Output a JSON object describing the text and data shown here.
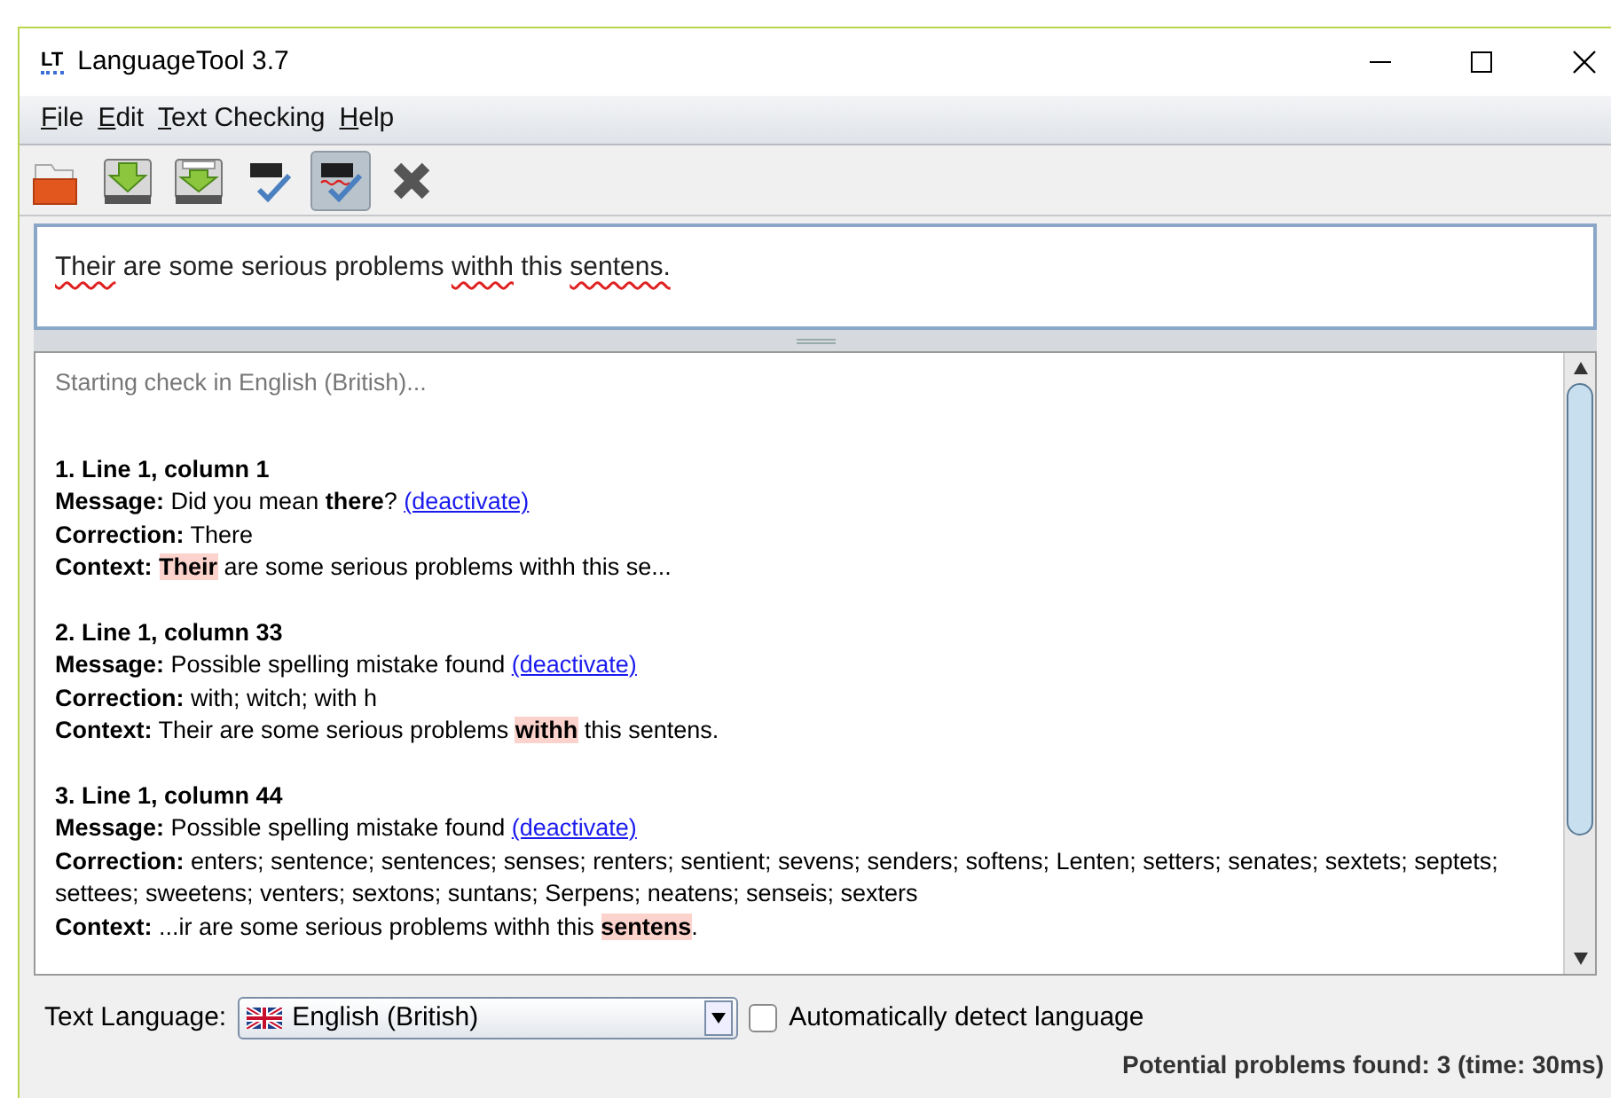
{
  "window": {
    "logo": "LT",
    "title": "LanguageTool 3.7"
  },
  "menu": [
    {
      "label": "File"
    },
    {
      "label": "Edit"
    },
    {
      "label": "Text Checking"
    },
    {
      "label": "Help"
    }
  ],
  "toolbar": [
    {
      "kind": "open",
      "selected": false
    },
    {
      "kind": "save",
      "selected": false
    },
    {
      "kind": "save_as",
      "selected": false
    },
    {
      "kind": "check",
      "selected": false
    },
    {
      "kind": "autocheck",
      "selected": true
    },
    {
      "kind": "close",
      "selected": false
    }
  ],
  "editor": {
    "segments": [
      {
        "text": "Their",
        "error": true
      },
      {
        "text": " are some serious problems ",
        "error": false
      },
      {
        "text": "withh",
        "error": true
      },
      {
        "text": " this ",
        "error": false
      },
      {
        "text": "sentens.",
        "error": true
      }
    ]
  },
  "results": {
    "status": "Starting check in English (British)...",
    "matches": [
      {
        "heading": "1. Line 1, column 1",
        "message": {
          "label": "Message:",
          "text": "Did you mean **there**?",
          "link": "(deactivate)"
        },
        "correction": {
          "label": "Correction:",
          "text": "There"
        },
        "context": {
          "label": "Context:",
          "highlight": "Their",
          "after": " are some serious problems withh this se..."
        }
      },
      {
        "heading": "2. Line 1, column 33",
        "message": {
          "label": "Message:",
          "text": "Possible spelling mistake found",
          "link": "(deactivate)"
        },
        "correction": {
          "label": "Correction:",
          "text": "with; witch; with h"
        },
        "context": {
          "label": "Context:",
          "before": "Their are some serious problems ",
          "highlight": "withh",
          "after": " this sentens."
        }
      },
      {
        "heading": "3. Line 1, column 44",
        "message": {
          "label": "Message:",
          "text": "Possible spelling mistake found",
          "link": "(deactivate)"
        },
        "correction": {
          "label": "Correction:",
          "text": "enters; sentence; sentences; senses; renters; sentient; sevens; senders; softens; Lenten; setters; senates; sextets; septets; settees; sweetens; venters; sextons; suntans; Serpens; neatens; senseis; sexters"
        },
        "context": {
          "label": "Context:",
          "before": "...ir are some serious problems withh this ",
          "highlight": "sentens",
          "after": "."
        }
      }
    ]
  },
  "footer": {
    "language_label": "Text Language:",
    "language": "English (British)",
    "auto_detect": {
      "label": "Automatically detect language",
      "checked": false
    },
    "status": "Potential problems found: 3 (time: 30ms)"
  }
}
